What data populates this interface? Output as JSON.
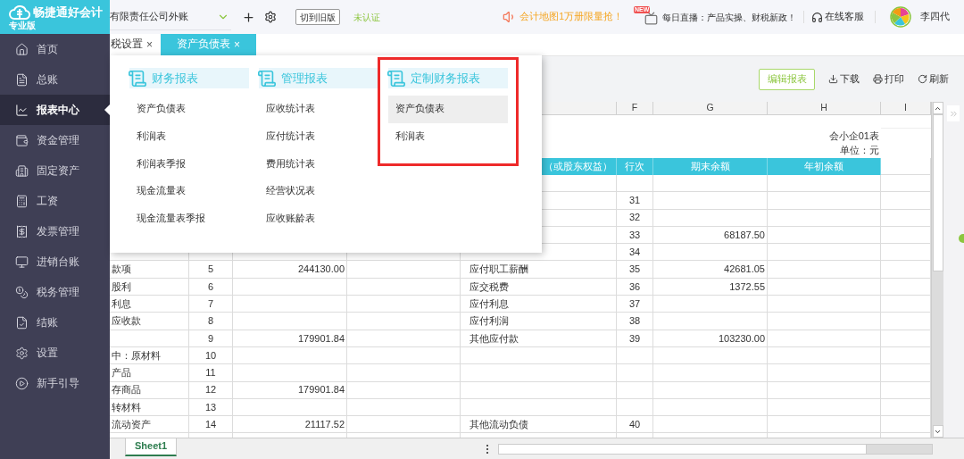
{
  "app": {
    "logo": "畅捷通好会计",
    "edition": "专业版"
  },
  "sidebar": {
    "items": [
      {
        "label": "首页",
        "kind": "home",
        "selected": false
      },
      {
        "label": "总账",
        "kind": "ledger",
        "selected": false
      },
      {
        "label": "报表中心",
        "kind": "reports",
        "selected": true
      },
      {
        "label": "资金管理",
        "kind": "funds",
        "selected": false
      },
      {
        "label": "固定资产",
        "kind": "assets",
        "selected": false
      },
      {
        "label": "工资",
        "kind": "payroll",
        "selected": false
      },
      {
        "label": "发票管理",
        "kind": "invoice",
        "selected": false
      },
      {
        "label": "进销台账",
        "kind": "stock",
        "selected": false
      },
      {
        "label": "税务管理",
        "kind": "tax",
        "selected": false
      },
      {
        "label": "结账",
        "kind": "close",
        "selected": false
      },
      {
        "label": "设置",
        "kind": "settings",
        "selected": false
      },
      {
        "label": "新手引导",
        "kind": "guide",
        "selected": false
      }
    ]
  },
  "topbar": {
    "company": "有限责任公司外账",
    "switch_button": "切到旧版",
    "cert_status": "未认证",
    "promo": "会计地图1万册限量抢！",
    "live_badge": "NEW",
    "live": "每日直播：产品实操、财税新政！",
    "support": "在线客服",
    "user": "李四代"
  },
  "tabs": [
    {
      "label": "税设置",
      "close": "×",
      "selected": false
    },
    {
      "label": "资产负债表",
      "close": "×",
      "selected": true
    }
  ],
  "toolbar": {
    "edit_button": "编辑报表",
    "actions": [
      {
        "label": "下载",
        "kind": "download"
      },
      {
        "label": "打印",
        "kind": "print"
      },
      {
        "label": "刷新",
        "kind": "refresh"
      }
    ]
  },
  "sheet": {
    "column_headers": [
      "F",
      "G",
      "H",
      "I"
    ],
    "form_no": "会小企01表",
    "unit": "单位：元",
    "header": {
      "liab_item": "（或股东权益）",
      "liab_line": "行次",
      "liab_end": "期末余额",
      "liab_begin": "年初余额"
    },
    "rows": [
      {},
      {
        "liab_line": "31"
      },
      {
        "liab_line": "32"
      },
      {
        "liab_line": "33",
        "liab_end": "68187.50"
      },
      {
        "liab_line": "34"
      },
      {
        "item": "款项",
        "line": "5",
        "end": "244130.00",
        "liab_item": "应付职工薪酬",
        "liab_line": "35",
        "liab_end": "42681.05"
      },
      {
        "item": "股利",
        "line": "6",
        "liab_item": "应交税费",
        "liab_line": "36",
        "liab_end": "1372.55"
      },
      {
        "item": "利息",
        "line": "7",
        "liab_item": "应付利息",
        "liab_line": "37"
      },
      {
        "item": "应收款",
        "line": "8",
        "liab_item": "应付利润",
        "liab_line": "38"
      },
      {
        "line": "9",
        "end": "179901.84",
        "liab_item": "其他应付款",
        "liab_line": "39",
        "liab_end": "103230.00"
      },
      {
        "item": "中：原材料",
        "line": "10"
      },
      {
        "item": "产品",
        "line": "11"
      },
      {
        "item": "存商品",
        "line": "12",
        "end": "179901.84"
      },
      {
        "item": "转材料",
        "line": "13"
      },
      {
        "item": "流动资产",
        "line": "14",
        "end": "21117.52",
        "liab_item": "其他流动负债",
        "liab_line": "40"
      },
      {}
    ]
  },
  "sheet_tabs": [
    {
      "label": "Sheet1",
      "selected": true
    }
  ],
  "menu": {
    "groups": [
      {
        "title": "财务报表",
        "highlighted": false,
        "items": [
          {
            "label": "资产负债表",
            "selected": false
          },
          {
            "label": "利润表",
            "selected": false
          },
          {
            "label": "利润表季报",
            "selected": false
          },
          {
            "label": "现金流量表",
            "selected": false
          },
          {
            "label": "现金流量表季报",
            "selected": false
          }
        ]
      },
      {
        "title": "管理报表",
        "highlighted": false,
        "items": [
          {
            "label": "应收统计表",
            "selected": false
          },
          {
            "label": "应付统计表",
            "selected": false
          },
          {
            "label": "费用统计表",
            "selected": false
          },
          {
            "label": "经营状况表",
            "selected": false
          },
          {
            "label": "应收账龄表",
            "selected": false
          }
        ]
      },
      {
        "title": "定制财务报表",
        "highlighted": true,
        "items": [
          {
            "label": "资产负债表",
            "selected": true
          },
          {
            "label": "利润表",
            "selected": false
          }
        ]
      }
    ]
  }
}
